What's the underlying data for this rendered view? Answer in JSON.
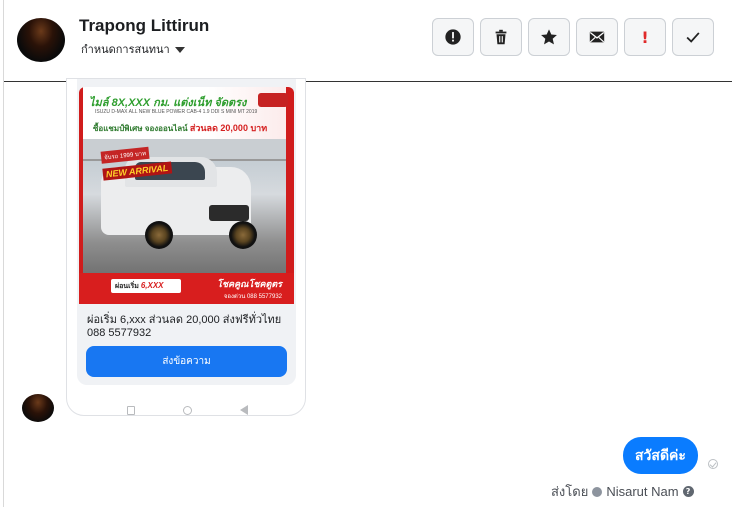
{
  "header": {
    "contact_name": "Trapong Littirun",
    "label_picker": "กำหนดการสนทนา",
    "actions": [
      {
        "name": "spam-icon"
      },
      {
        "name": "trash-icon"
      },
      {
        "name": "star-icon"
      },
      {
        "name": "envelope-icon"
      },
      {
        "name": "exclamation-icon",
        "glyph": "!"
      },
      {
        "name": "check-icon"
      }
    ]
  },
  "incoming_card": {
    "ad": {
      "headline": "ไมล์ 8X,XXX กม. แต่งเน็ท จัดตรง",
      "subline": "ISUZU D-MAX ALL NEW BLUE POWER CAB-4 1.9 DDI S MINI MT 2019",
      "promo_prefix": "ซื้อแชมป์พิเศษ จองออนไลน์",
      "promo_amount": "ส่วนลด 20,000 บาท",
      "tag_top": "จับรถ 1999 บาท",
      "tag_main": "NEW ARRIVAL",
      "price_prefix": "ผ่อนเริ่ม",
      "price_value": "6,XXX",
      "brand": "โชคคูณโชคตูตร",
      "phone": "จองด่วน 088 5577932"
    },
    "caption": "ผ่อเริ่ม 6,xxx ส่วนลด 20,000 ส่งฟรีทั่วไทย 088 5577932",
    "button_label": "ส่งข้อความ"
  },
  "outgoing": {
    "message": "สวัสดีค่ะ",
    "sent_by_prefix": "ส่งโดย",
    "sender": "Nisarut Nam",
    "help_glyph": "?"
  },
  "colors": {
    "accent": "#1877f2",
    "bubble": "#0a7cff",
    "danger": "#e02a2a"
  }
}
